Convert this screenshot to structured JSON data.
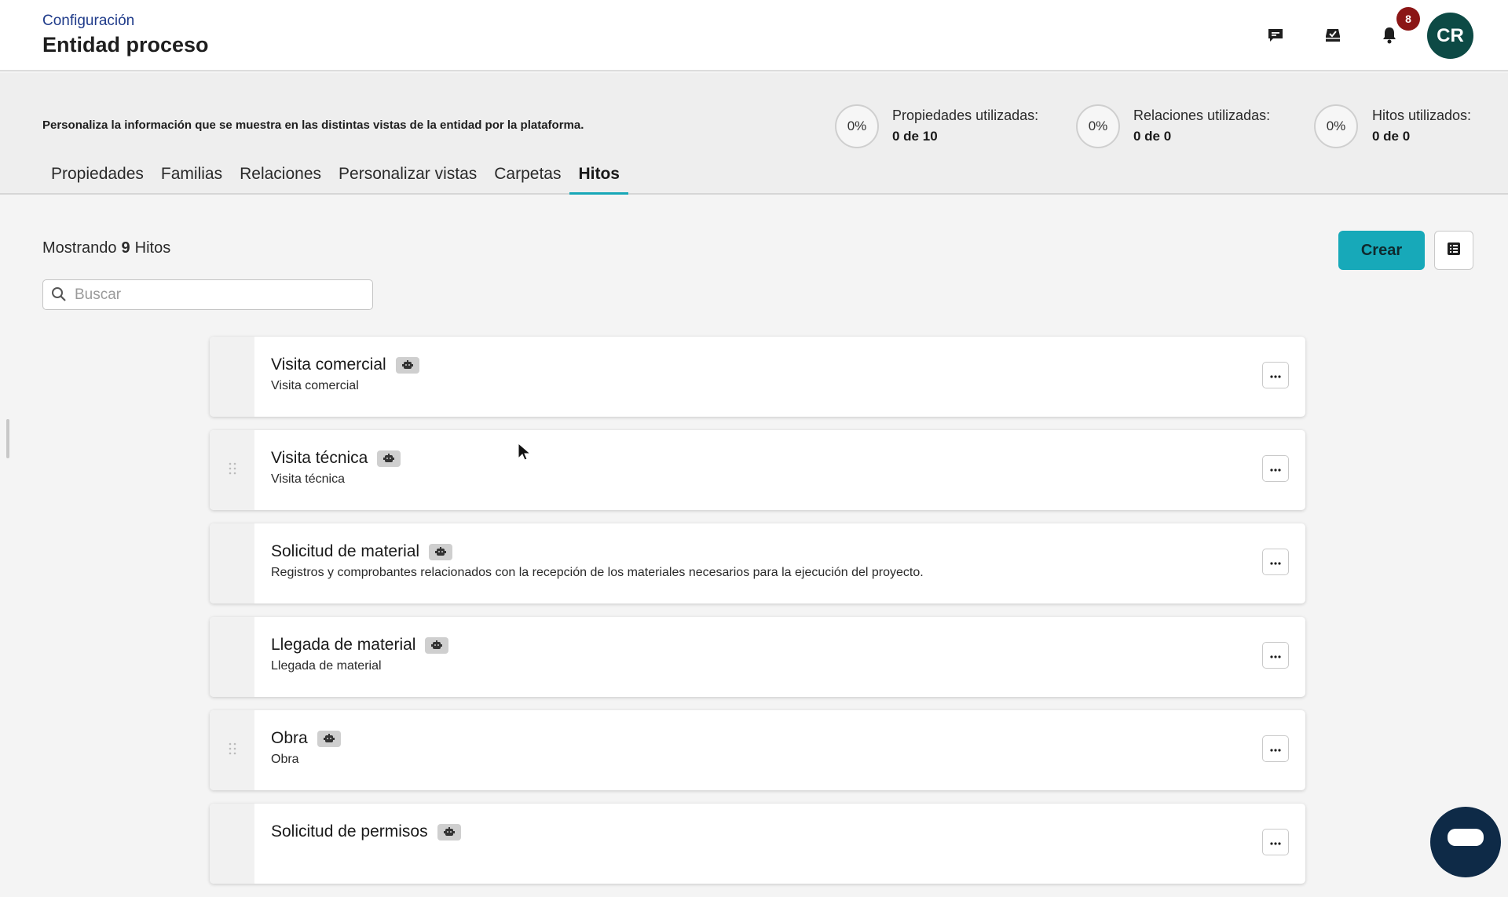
{
  "header": {
    "breadcrumb": "Configuración",
    "title": "Entidad proceso",
    "notifications_count": "8",
    "avatar_initials": "CR",
    "icons": [
      "chat-icon",
      "inbox-check-icon",
      "bell-icon"
    ]
  },
  "info": {
    "description": "Personaliza la información que se muestra en las distintas vistas de la entidad por la plataforma.",
    "stats": [
      {
        "percent": "0%",
        "label": "Propiedades utilizadas:",
        "value": "0 de 10"
      },
      {
        "percent": "0%",
        "label": "Relaciones utilizadas:",
        "value": "0 de 0"
      },
      {
        "percent": "0%",
        "label": "Hitos utilizados:",
        "value": "0 de 0"
      }
    ]
  },
  "tabs": [
    {
      "label": "Propiedades",
      "active": false
    },
    {
      "label": "Familias",
      "active": false
    },
    {
      "label": "Relaciones",
      "active": false
    },
    {
      "label": "Personalizar vistas",
      "active": false
    },
    {
      "label": "Carpetas",
      "active": false
    },
    {
      "label": "Hitos",
      "active": true
    }
  ],
  "toolbar": {
    "showing_prefix": "Mostrando",
    "showing_count": "9",
    "showing_suffix": "Hitos",
    "search_placeholder": "Buscar",
    "create_label": "Crear"
  },
  "milestones": [
    {
      "title": "Visita comercial",
      "description": "Visita comercial"
    },
    {
      "title": "Visita técnica",
      "description": "Visita técnica"
    },
    {
      "title": "Solicitud de material",
      "description": "Registros y comprobantes relacionados con la recepción de los materiales necesarios para la ejecución del proyecto."
    },
    {
      "title": "Llegada de material",
      "description": "Llegada de material"
    },
    {
      "title": "Obra",
      "description": "Obra"
    },
    {
      "title": "Solicitud de permisos",
      "description": ""
    }
  ],
  "colors": {
    "accent": "#17a9b9",
    "breadcrumb": "#1f3b8a",
    "avatar": "#0d4a45",
    "badge": "#8b1616",
    "fab": "#0e2a47"
  }
}
